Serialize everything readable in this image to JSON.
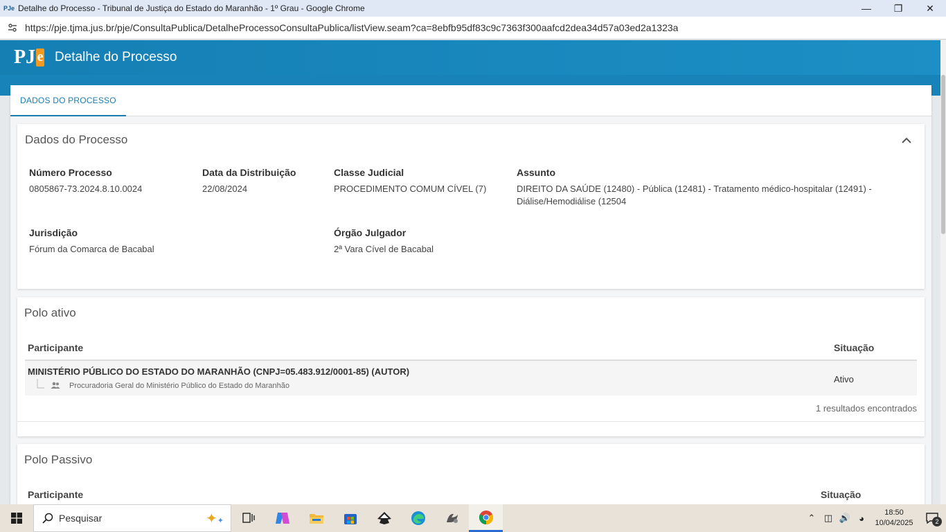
{
  "browser": {
    "window_title": "Detalhe do Processo - Tribunal de Justiça do Estado do Maranhão - 1º Grau - Google Chrome",
    "url": "https://pje.tjma.jus.br/pje/ConsultaPublica/DetalheProcessoConsultaPublica/listView.seam?ca=8ebfb95df83c9c7363f300aafcd2dea34d57a03ed2a1323a",
    "favicon_text": "PJe"
  },
  "header": {
    "logo_pj": "PJ",
    "logo_e": "e",
    "title": "Detalhe do Processo"
  },
  "tabs": [
    {
      "label": "DADOS DO PROCESSO"
    }
  ],
  "dados_processo": {
    "title": "Dados do Processo",
    "fields": {
      "numero_label": "Número Processo",
      "numero_value": "0805867-73.2024.8.10.0024",
      "data_label": "Data da Distribuição",
      "data_value": "22/08/2024",
      "classe_label": "Classe Judicial",
      "classe_value": "PROCEDIMENTO COMUM CÍVEL (7)",
      "assunto_label": "Assunto",
      "assunto_value_line1": "DIREITO DA SAÚDE (12480) - Pública (12481) - Tratamento médico-hospitalar (12491) -",
      "assunto_value_line2": "Diálise/Hemodiálise (12504",
      "jurisdicao_label": "Jurisdição",
      "jurisdicao_value": "Fórum da Comarca de Bacabal",
      "orgao_label": "Órgão Julgador",
      "orgao_value": "2ª Vara Cível de Bacabal"
    }
  },
  "polo_ativo": {
    "title": "Polo ativo",
    "col_participante": "Participante",
    "col_situacao": "Situação",
    "rows": [
      {
        "name": "MINISTÉRIO PÚBLICO DO ESTADO DO MARANHÃO (CNPJ=05.483.912/0001-85) (AUTOR)",
        "sub": "Procuradoria Geral do Ministério Público do Estado do Maranhão",
        "status": "Ativo"
      }
    ],
    "results": "1 resultados encontrados"
  },
  "polo_passivo": {
    "title": "Polo Passivo",
    "col_participante": "Participante",
    "col_situacao": "Situação"
  },
  "taskbar": {
    "search_label": "Pesquisar",
    "time": "18:50",
    "date": "10/04/2025",
    "notification_count": "2"
  }
}
